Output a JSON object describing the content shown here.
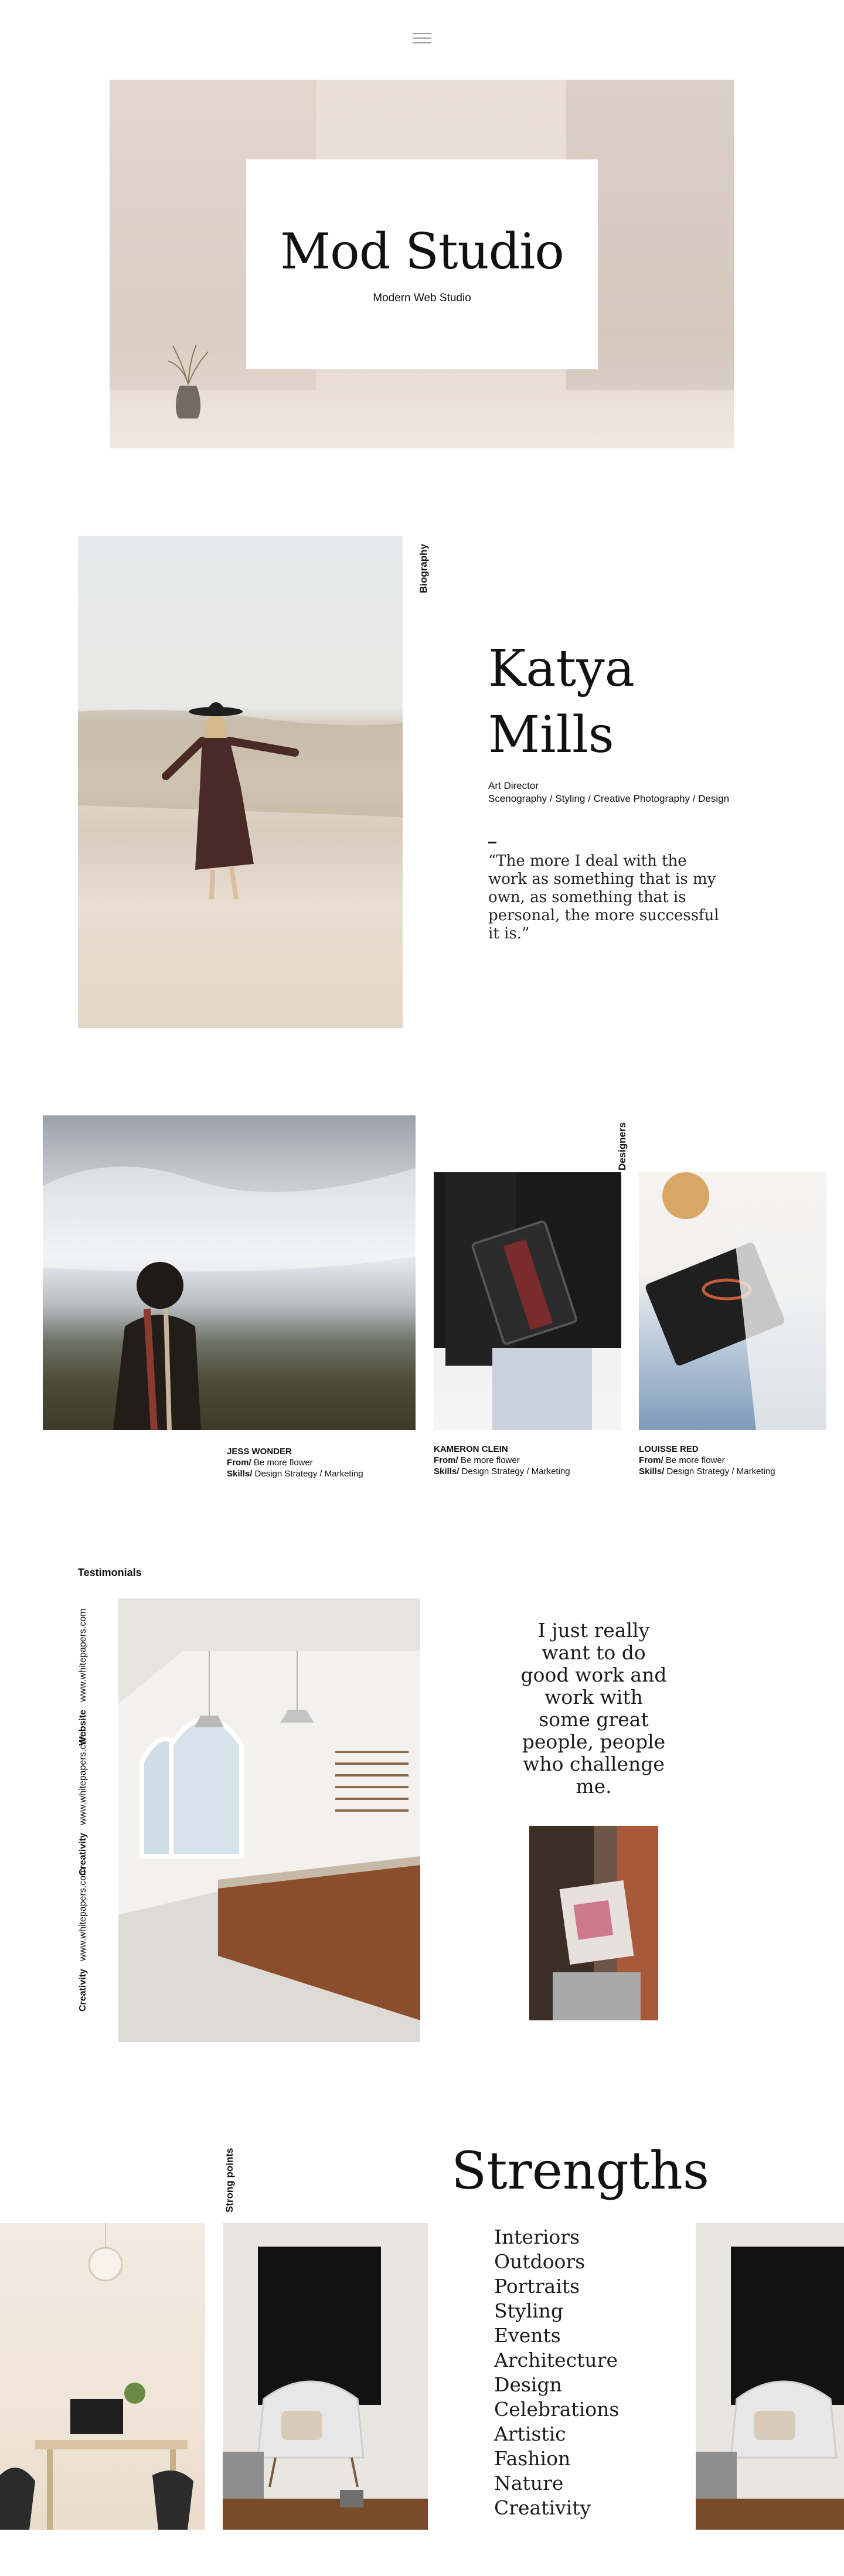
{
  "hero": {
    "title": "Mod Studio",
    "subtitle": "Modern Web Studio"
  },
  "biography": {
    "label": "Biography",
    "name_line1": "Katya",
    "name_line2": "Mills",
    "role": "Art Director",
    "skills": "Scenography / Styling / Creative Photography / Design",
    "quote": "“The more I deal with the work as something that is my own, as something that is personal, the more successful it is.”"
  },
  "designers": {
    "label": "Designers",
    "people": [
      {
        "name": "JESS WONDER",
        "from_label": "From/",
        "from": "Be more flower",
        "skills_label": "Skills/",
        "skills": "Design Strategy / Marketing"
      },
      {
        "name": "KAMERON CLEIN",
        "from_label": "From/",
        "from": "Be more flower",
        "skills_label": "Skills/",
        "skills": "Design Strategy / Marketing"
      },
      {
        "name": "LOUISSE RED",
        "from_label": "From/",
        "from": "Be more flower",
        "skills_label": "Skills/",
        "skills": "Design Strategy / Marketing"
      }
    ]
  },
  "testimonials": {
    "label": "Testimonials",
    "links": [
      {
        "label": "Website",
        "url": "www.whitepapers.com"
      },
      {
        "label": "Creativity",
        "url": "www.whitepapers.com"
      },
      {
        "label": "Creativity",
        "url": "www.whitepapers.com"
      }
    ],
    "quote": "I just really want to do good work and work with some great people, people who challenge me."
  },
  "strengths": {
    "label": "Strong points",
    "title": "Strengths",
    "items": [
      "Interiors",
      "Outdoors",
      "Portraits",
      "Styling",
      "Events",
      "Architecture",
      "Design",
      "Celebrations",
      "Artistic",
      "Fashion",
      "Nature",
      "Creativity"
    ]
  },
  "colors": {
    "text": "#111111",
    "hero_backdrop": "#dccdc2",
    "menu_icon": "#9a9a9a"
  },
  "icons": [
    "menu-icon"
  ]
}
